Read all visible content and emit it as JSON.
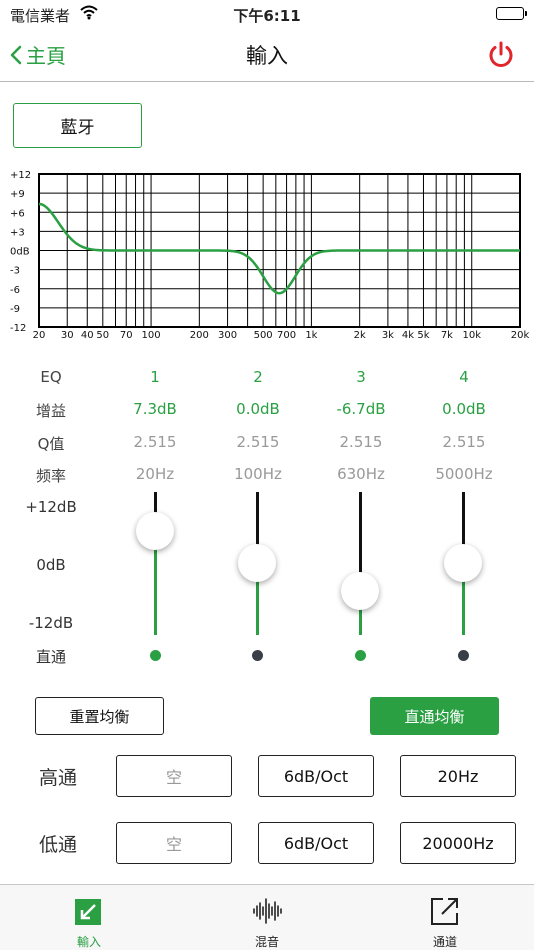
{
  "status_bar": {
    "carrier": "電信業者",
    "time": "下午6:11"
  },
  "nav": {
    "back_label": "主頁",
    "title": "輸入"
  },
  "source_button": "藍牙",
  "graph": {
    "y_ticks": [
      "+12",
      "+9",
      "+6",
      "+3",
      "0dB",
      "-3",
      "-6",
      "-9",
      "-12"
    ],
    "x_ticks": [
      "20",
      "30",
      "40",
      "50",
      "70",
      "100",
      "200",
      "300",
      "500",
      "700",
      "1k",
      "2k",
      "3k",
      "4k",
      "5k",
      "7k",
      "10k",
      "20k"
    ]
  },
  "eq": {
    "row_labels": {
      "eq": "EQ",
      "gain": "增益",
      "q": "Q值",
      "freq": "频率",
      "bypass": "直通"
    },
    "bands": [
      {
        "id": "1",
        "gain": "7.3dB",
        "q": "2.515",
        "freq": "20Hz",
        "gain_db": 7.3,
        "bypass": true
      },
      {
        "id": "2",
        "gain": "0.0dB",
        "q": "2.515",
        "freq": "100Hz",
        "gain_db": 0.0,
        "bypass": false
      },
      {
        "id": "3",
        "gain": "-6.7dB",
        "q": "2.515",
        "freq": "630Hz",
        "gain_db": -6.7,
        "bypass": true
      },
      {
        "id": "4",
        "gain": "0.0dB",
        "q": "2.515",
        "freq": "5000Hz",
        "gain_db": 0.0,
        "bypass": false
      }
    ],
    "scale": {
      "top": "+12dB",
      "mid": "0dB",
      "bottom": "-12dB"
    }
  },
  "buttons": {
    "reset": "重置均衡",
    "flat": "直通均衡"
  },
  "filters": {
    "highpass": {
      "label": "高通",
      "type": "空",
      "slope": "6dB/Oct",
      "freq": "20Hz"
    },
    "lowpass": {
      "label": "低通",
      "type": "空",
      "slope": "6dB/Oct",
      "freq": "20000Hz"
    }
  },
  "tabs": [
    {
      "label": "輸入",
      "icon": "input-edit-icon"
    },
    {
      "label": "混音",
      "icon": "waveform-icon"
    },
    {
      "label": "通道",
      "icon": "share-export-icon"
    }
  ],
  "colors": {
    "accent": "#2aa043",
    "power": "#e0262b",
    "off_dot": "#3a3f47"
  }
}
